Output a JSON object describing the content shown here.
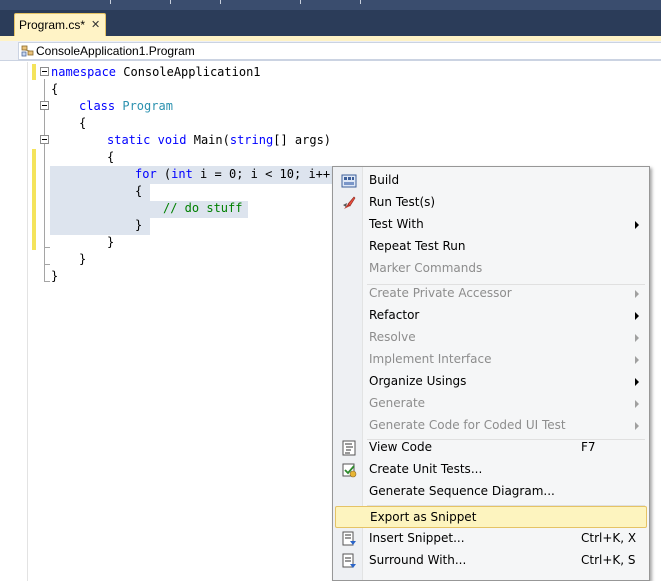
{
  "tab": {
    "title": "Program.cs*",
    "close_glyph": "✕"
  },
  "navbar": {
    "scope": "ConsoleApplication1.Program",
    "icon": "class-icon"
  },
  "code": {
    "l1": {
      "kw": "namespace",
      "rest": " ConsoleApplication1"
    },
    "l2": "{",
    "l3": {
      "kw": "class",
      "type": "Program"
    },
    "l4": "{",
    "l5": {
      "kw1": "static",
      "kw2": "void",
      "mid": " Main(",
      "type": "string",
      "end": "[] args)"
    },
    "l6": "{",
    "l7": {
      "kw1": "for",
      "p1": " (",
      "kw2": "int",
      "p2": " i = ",
      "n1": "0",
      "p3": "; i < ",
      "n2": "10",
      "p4": "; i++)"
    },
    "l8": "{",
    "l9": "// do stuff",
    "l10": "}",
    "l11": "}",
    "l12": "}",
    "l13": "}"
  },
  "colors": {
    "keyword": "#0000ff",
    "type": "#2b91af",
    "comment": "#008000",
    "selection": "#dde4ee",
    "menu_hover": "#fdf4bf"
  },
  "menu": {
    "items": [
      {
        "label": "Build",
        "icon": "build-icon"
      },
      {
        "label": "Run Test(s)",
        "icon": "run-tests-icon"
      },
      {
        "label": "Test With"
      },
      {
        "label": "Repeat Test Run"
      },
      {
        "label": "Marker Commands"
      },
      {
        "label": "Create Private Accessor"
      },
      {
        "label": "Refactor"
      },
      {
        "label": "Resolve"
      },
      {
        "label": "Implement Interface"
      },
      {
        "label": "Organize Usings"
      },
      {
        "label": "Generate"
      },
      {
        "label": "Generate Code for Coded UI Test"
      },
      {
        "label": "View Code",
        "shortcut": "F7",
        "icon": "view-code-icon"
      },
      {
        "label": "Create Unit Tests...",
        "icon": "unit-test-icon"
      },
      {
        "label": "Generate Sequence Diagram..."
      },
      {
        "label": "Export as Snippet"
      },
      {
        "label": "Insert Snippet...",
        "shortcut": "Ctrl+K, X",
        "icon": "insert-snippet-icon"
      },
      {
        "label": "Surround With...",
        "shortcut": "Ctrl+K, S",
        "icon": "surround-with-icon"
      }
    ]
  }
}
